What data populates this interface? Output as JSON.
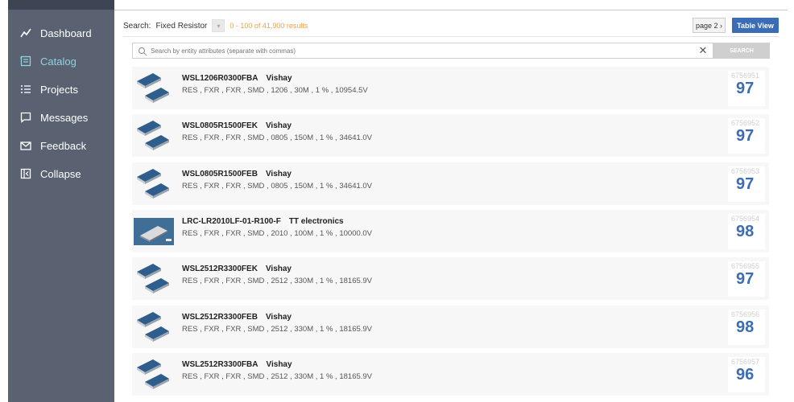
{
  "sidebar": {
    "items": [
      {
        "label": "Dashboard",
        "icon": "chart-line-icon",
        "active": false
      },
      {
        "label": "Catalog",
        "icon": "catalog-icon",
        "active": true
      },
      {
        "label": "Projects",
        "icon": "list-icon",
        "active": false
      },
      {
        "label": "Messages",
        "icon": "message-icon",
        "active": false
      },
      {
        "label": "Feedback",
        "icon": "mail-icon",
        "active": false
      },
      {
        "label": "Collapse",
        "icon": "collapse-icon",
        "active": false
      }
    ]
  },
  "toolbar": {
    "search_label": "Search:",
    "search_category": "Fixed Resistor",
    "results_text": "0 - 100  of  41,900 results",
    "page_label": "page 2 ›",
    "table_view_label": "Table View"
  },
  "search": {
    "placeholder": "Search by entity attributes (separate with commas)",
    "clear_glyph": "✕",
    "button_label": "SEARCH"
  },
  "results": [
    {
      "part": "WSL1206R0300FBA",
      "manufacturer": "Vishay",
      "attributes": "RES ,  FXR ,  FXR ,  SMD ,  1206 ,  30M ,  1 % ,  10954.5V",
      "id": "6756951",
      "score": "97",
      "thumb": "chip"
    },
    {
      "part": "WSL0805R1500FEK",
      "manufacturer": "Vishay",
      "attributes": "RES ,  FXR ,  FXR ,  SMD ,  0805 ,  150M ,  1 % ,  34641.0V",
      "id": "6756952",
      "score": "97",
      "thumb": "chip"
    },
    {
      "part": "WSL0805R1500FEB",
      "manufacturer": "Vishay",
      "attributes": "RES ,  FXR ,  FXR ,  SMD ,  0805 ,  150M ,  1 % ,  34641.0V",
      "id": "6756953",
      "score": "97",
      "thumb": "chip"
    },
    {
      "part": "LRC-LR2010LF-01-R100-F",
      "manufacturer": "TT electronics",
      "attributes": "RES ,  FXR ,  FXR ,  SMD ,  2010 ,  100M ,  1 % ,  10000.0V",
      "id": "6756954",
      "score": "98",
      "thumb": "photo"
    },
    {
      "part": "WSL2512R3300FEK",
      "manufacturer": "Vishay",
      "attributes": "RES ,  FXR ,  FXR ,  SMD ,  2512 ,  330M ,  1 % ,  18165.9V",
      "id": "6756955",
      "score": "97",
      "thumb": "chip"
    },
    {
      "part": "WSL2512R3300FEB",
      "manufacturer": "Vishay",
      "attributes": "RES ,  FXR ,  FXR ,  SMD ,  2512 ,  330M ,  1 % ,  18165.9V",
      "id": "6756956",
      "score": "98",
      "thumb": "chip"
    },
    {
      "part": "WSL2512R3300FBA",
      "manufacturer": "Vishay",
      "attributes": "RES ,  FXR ,  FXR ,  SMD ,  2512 ,  330M ,  1 % ,  18165.9V",
      "id": "6756957",
      "score": "96",
      "thumb": "chip"
    }
  ],
  "colors": {
    "sidebar_bg": "#5a6272",
    "active_nav": "#8fd3e0",
    "accent_blue": "#3b6cb5",
    "results_orange": "#f0a046"
  }
}
